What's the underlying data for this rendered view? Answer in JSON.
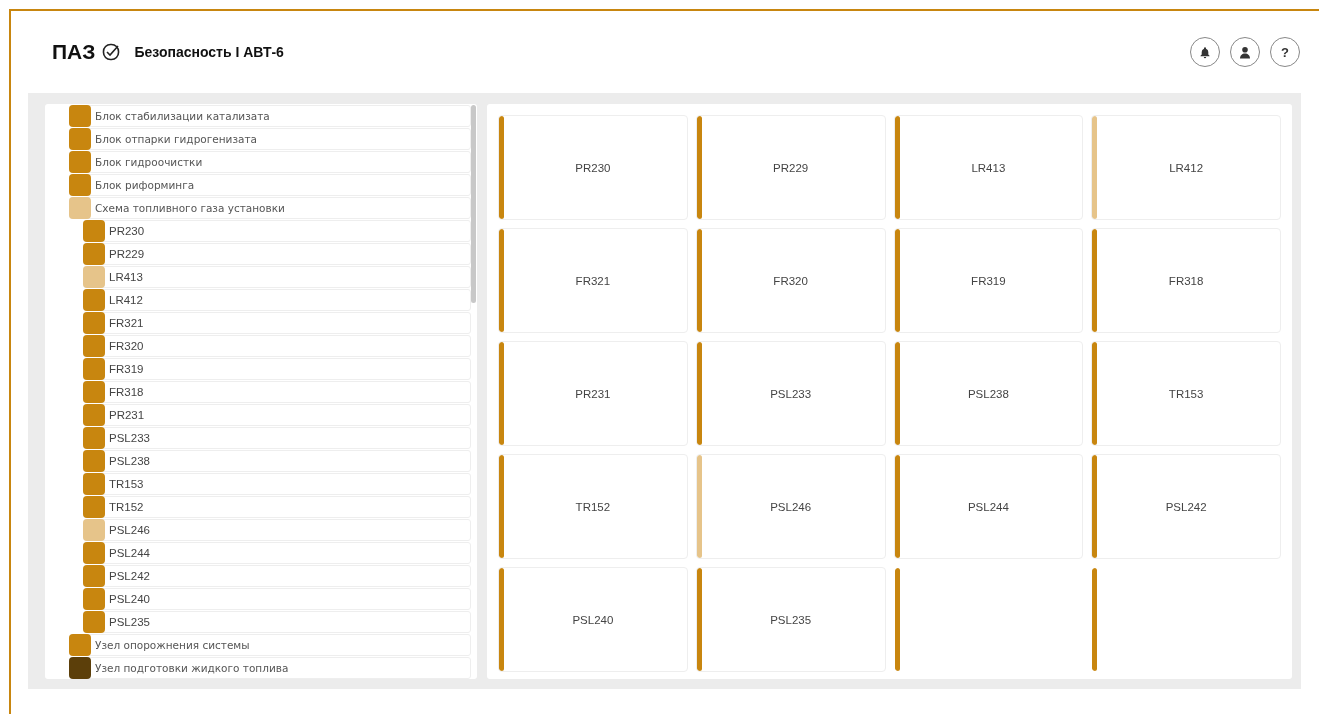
{
  "header": {
    "logo": "ПАЗ",
    "title": "Безопасность I АВТ-6",
    "buttons": [
      {
        "kind": "bell"
      },
      {
        "kind": "user"
      },
      {
        "kind": "help",
        "label": "?"
      }
    ]
  },
  "tree": {
    "items": [
      {
        "label": "Блок стабилизации катализата",
        "color": "#c8860f"
      },
      {
        "label": "Блок отпарки гидрогенизата",
        "color": "#c8860f"
      },
      {
        "label": "Блок гидроочистки",
        "color": "#c8860f"
      },
      {
        "label": "Блок риформинга",
        "color": "#c8860f"
      },
      {
        "label": "Схема топливного газа установки",
        "color": "#e6c48a",
        "children": [
          {
            "label": "PR230",
            "color": "#c8860f"
          },
          {
            "label": "PR229",
            "color": "#c8860f"
          },
          {
            "label": "LR413",
            "color": "#e6c48a"
          },
          {
            "label": "LR412",
            "color": "#c8860f"
          },
          {
            "label": "FR321",
            "color": "#c8860f"
          },
          {
            "label": "FR320",
            "color": "#c8860f"
          },
          {
            "label": "FR319",
            "color": "#c8860f"
          },
          {
            "label": "FR318",
            "color": "#c8860f"
          },
          {
            "label": "PR231",
            "color": "#c8860f"
          },
          {
            "label": "PSL233",
            "color": "#c8860f"
          },
          {
            "label": "PSL238",
            "color": "#c8860f"
          },
          {
            "label": "TR153",
            "color": "#c8860f"
          },
          {
            "label": "TR152",
            "color": "#c8860f"
          },
          {
            "label": "PSL246",
            "color": "#e6c48a"
          },
          {
            "label": "PSL244",
            "color": "#c8860f"
          },
          {
            "label": "PSL242",
            "color": "#c8860f"
          },
          {
            "label": "PSL240",
            "color": "#c8860f"
          },
          {
            "label": "PSL235",
            "color": "#c8860f"
          }
        ]
      },
      {
        "label": "Узел опорожнения системы",
        "color": "#c8860f"
      },
      {
        "label": "Узел подготовки жидкого топлива",
        "color": "#5c3f0a"
      }
    ]
  },
  "cards": [
    {
      "label": "PR230",
      "color": "#c8860f"
    },
    {
      "label": "PR229",
      "color": "#c8860f"
    },
    {
      "label": "LR413",
      "color": "#c8860f"
    },
    {
      "label": "LR412",
      "color": "#e6c48a"
    },
    {
      "label": "FR321",
      "color": "#c8860f"
    },
    {
      "label": "FR320",
      "color": "#c8860f"
    },
    {
      "label": "FR319",
      "color": "#c8860f"
    },
    {
      "label": "FR318",
      "color": "#c8860f"
    },
    {
      "label": "PR231",
      "color": "#c8860f"
    },
    {
      "label": "PSL233",
      "color": "#c8860f"
    },
    {
      "label": "PSL238",
      "color": "#c8860f"
    },
    {
      "label": "TR153",
      "color": "#c8860f"
    },
    {
      "label": "TR152",
      "color": "#c8860f"
    },
    {
      "label": "PSL246",
      "color": "#e6c48a"
    },
    {
      "label": "PSL244",
      "color": "#c8860f"
    },
    {
      "label": "PSL242",
      "color": "#c8860f"
    },
    {
      "label": "PSL240",
      "color": "#c8860f"
    },
    {
      "label": "PSL235",
      "color": "#c8860f"
    },
    {
      "color": "#c8860f"
    },
    {
      "color": "#c8860f"
    }
  ]
}
